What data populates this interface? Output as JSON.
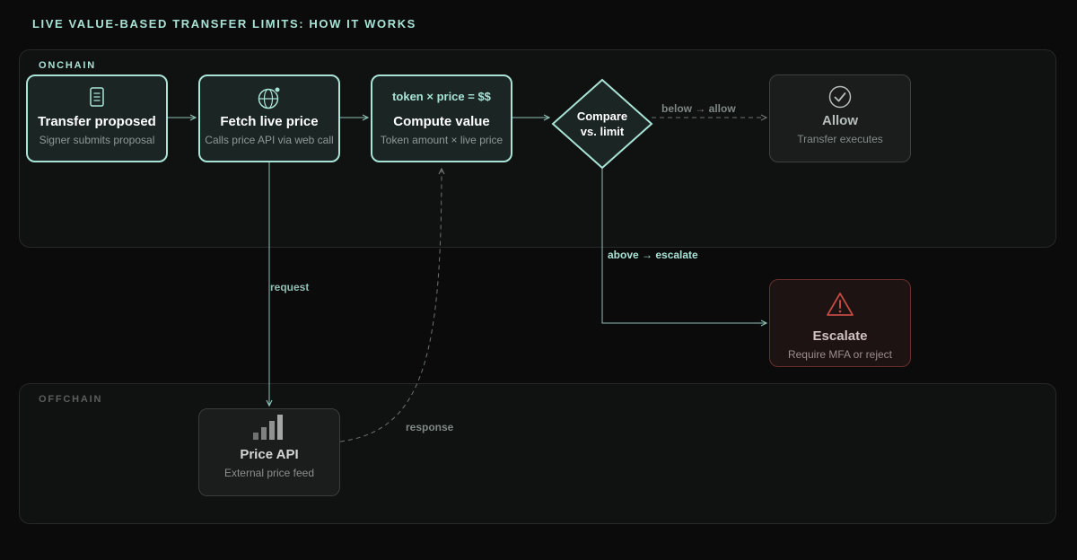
{
  "title": "LIVE VALUE-BASED TRANSFER LIMITS: HOW IT WORKS",
  "zones": {
    "onchain": "ONCHAIN",
    "offchain": "OFFCHAIN"
  },
  "nodes": {
    "transfer": {
      "title": "Transfer proposed",
      "subtitle": "Signer submits proposal",
      "icon": "document-icon"
    },
    "fetch": {
      "title": "Fetch live price",
      "subtitle": "Calls price API via web call",
      "icon": "globe-icon"
    },
    "compute": {
      "formula": "token × price = $$",
      "title": "Compute value",
      "subtitle": "Token amount × live price"
    },
    "compare": {
      "line1": "Compare",
      "line2": "vs. limit"
    },
    "allow": {
      "title": "Allow",
      "subtitle": "Transfer executes",
      "icon": "check-circle-icon"
    },
    "escalate": {
      "title": "Escalate",
      "subtitle": "Require MFA or reject",
      "icon": "warning-icon"
    },
    "price_api": {
      "title": "Price API",
      "subtitle": "External price feed",
      "icon": "bar-chart-icon"
    }
  },
  "edges": {
    "below": "below → allow",
    "above": "above → escalate",
    "request": "request",
    "response": "response"
  },
  "colors": {
    "accent": "#a8e3d6",
    "danger": "#c24a42",
    "background": "#0b0b0b"
  }
}
